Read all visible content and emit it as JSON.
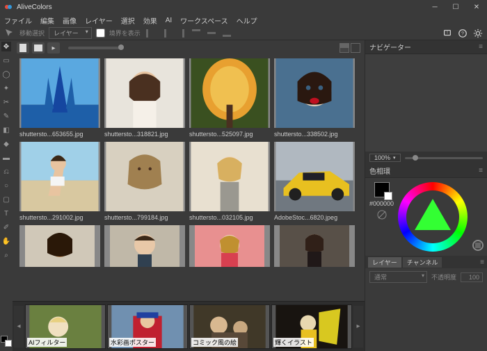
{
  "app_title": "AliveColors",
  "menu": [
    "ファイル",
    "編集",
    "画像",
    "レイヤー",
    "選択",
    "効果",
    "AI",
    "ワークスペース",
    "ヘルプ"
  ],
  "toolbar": {
    "move_label": "移動選択",
    "layer_dropdown": "レイヤー",
    "bounds_label": "境界を表示"
  },
  "thumbs": [
    {
      "label": "shuttersto...653655.jpg"
    },
    {
      "label": "shuttersto...318821.jpg"
    },
    {
      "label": "shuttersto...525097.jpg"
    },
    {
      "label": "shuttersto...338502.jpg"
    },
    {
      "label": "shuttersto...291002.jpg"
    },
    {
      "label": "shuttersto...799184.jpg"
    },
    {
      "label": "shuttersto...032105.jpg"
    },
    {
      "label": "AdobeStoc...6820.jpeg"
    }
  ],
  "filmstrip": [
    {
      "label": "AIフィルター"
    },
    {
      "label": "水彩画ポスター"
    },
    {
      "label": "コミック風の絵"
    },
    {
      "label": "輝くイラスト"
    }
  ],
  "panels": {
    "navigator": "ナビゲーター",
    "zoom": "100%",
    "color_title": "色相環",
    "hex": "#000000",
    "layers_tab": "レイヤー",
    "channels_tab": "チャンネル",
    "blend_mode": "通常",
    "opacity_label": "不透明度",
    "opacity_value": "100"
  }
}
